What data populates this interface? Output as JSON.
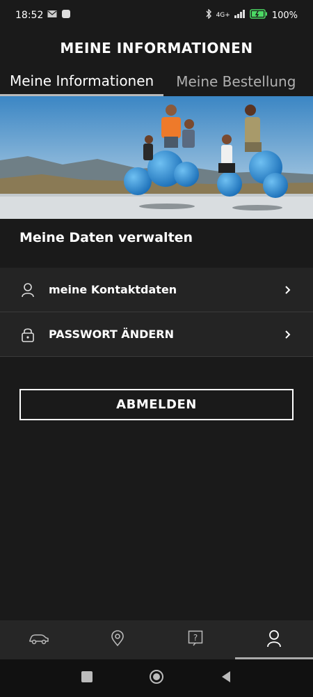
{
  "status_bar": {
    "time": "18:52",
    "network": "4G+",
    "battery": "100%"
  },
  "header": {
    "title": "MEINE INFORMATIONEN"
  },
  "tabs": [
    {
      "label": "Meine Informationen",
      "active": true
    },
    {
      "label": "Meine Bestellung",
      "active": false
    }
  ],
  "section": {
    "title": "Meine Daten verwalten"
  },
  "menu": [
    {
      "label": "meine Kontaktdaten",
      "icon": "user-icon"
    },
    {
      "label": "PASSWORT ÄNDERN",
      "icon": "lock-icon"
    }
  ],
  "logout_label": "ABMELDEN",
  "bottom_nav": [
    {
      "icon": "car-icon",
      "active": false
    },
    {
      "icon": "location-pin-icon",
      "active": false
    },
    {
      "icon": "help-icon",
      "active": false
    },
    {
      "icon": "profile-icon",
      "active": true
    }
  ],
  "colors": {
    "background": "#1a1a1a",
    "menu_item": "#242424",
    "text": "#ffffff",
    "muted_text": "#b0b0b0"
  }
}
